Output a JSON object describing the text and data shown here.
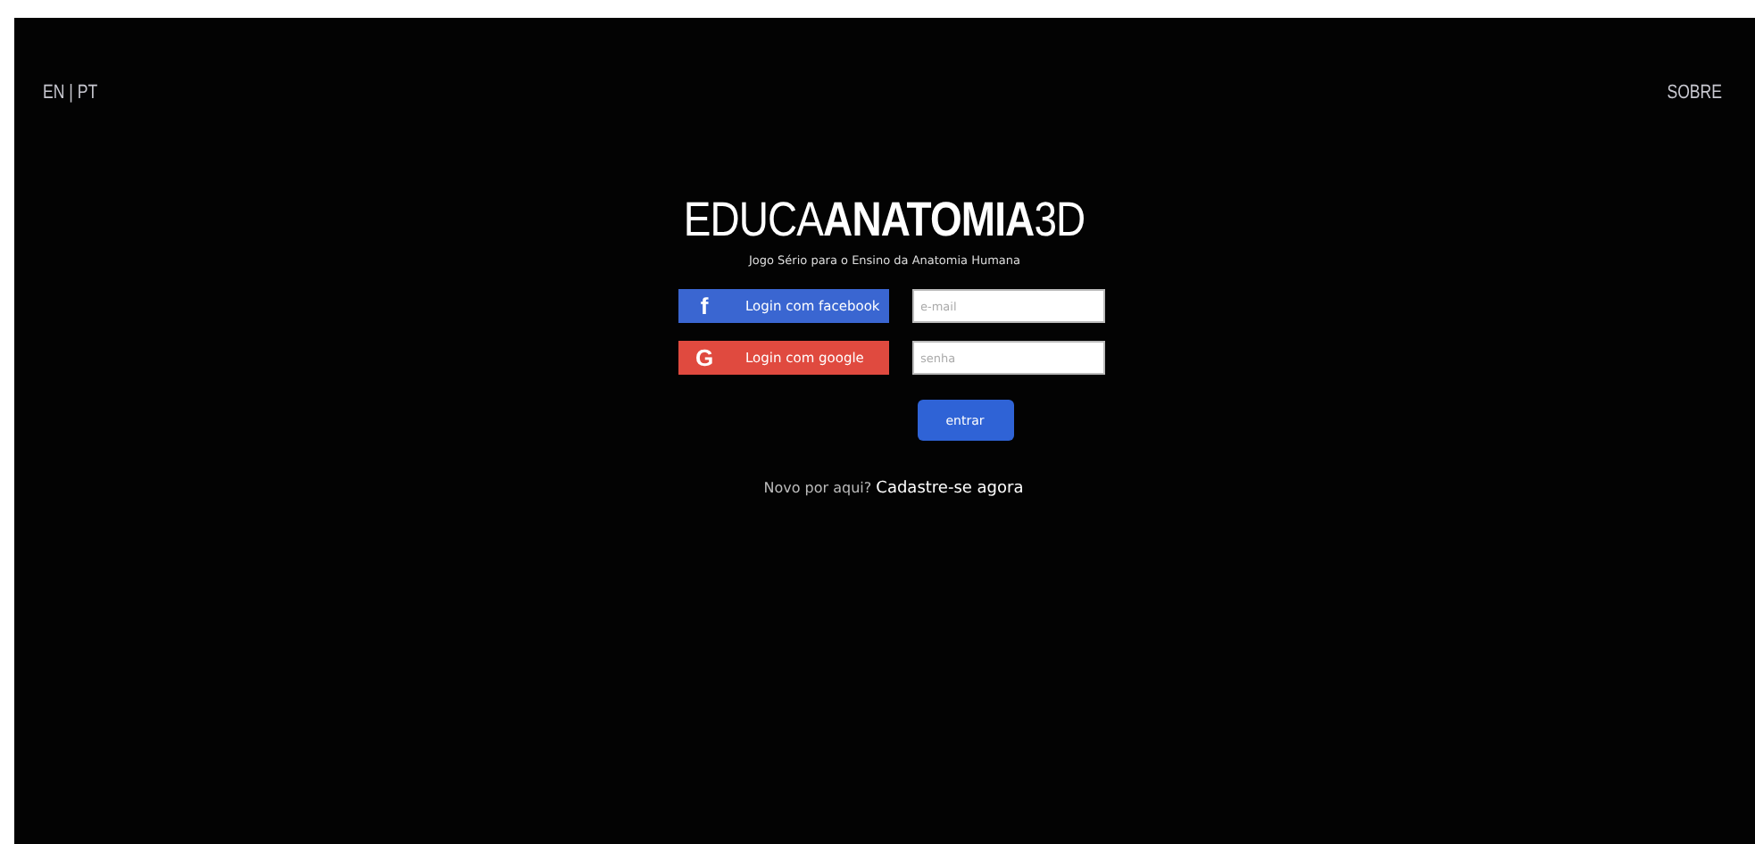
{
  "header": {
    "language": "EN | PT",
    "about": "SOBRE"
  },
  "logo": "EDUCA**ANATOMIA**3D",
  "subtitle": "Jogo Sério para o Ensino da Anatomia Humana",
  "social_buttons": [
    {
      "kind": "facebook",
      "label": "Login com facebook",
      "icon": "f"
    },
    {
      "kind": "google",
      "label": "Login com google",
      "icon": "G"
    }
  ],
  "fields": [
    {
      "placeholder": "e-mail"
    },
    {
      "placeholder": "senha"
    }
  ],
  "submit": "entrar",
  "signup": {
    "text": "Novo por aqui?",
    "link": "Cadastre-se agora"
  }
}
